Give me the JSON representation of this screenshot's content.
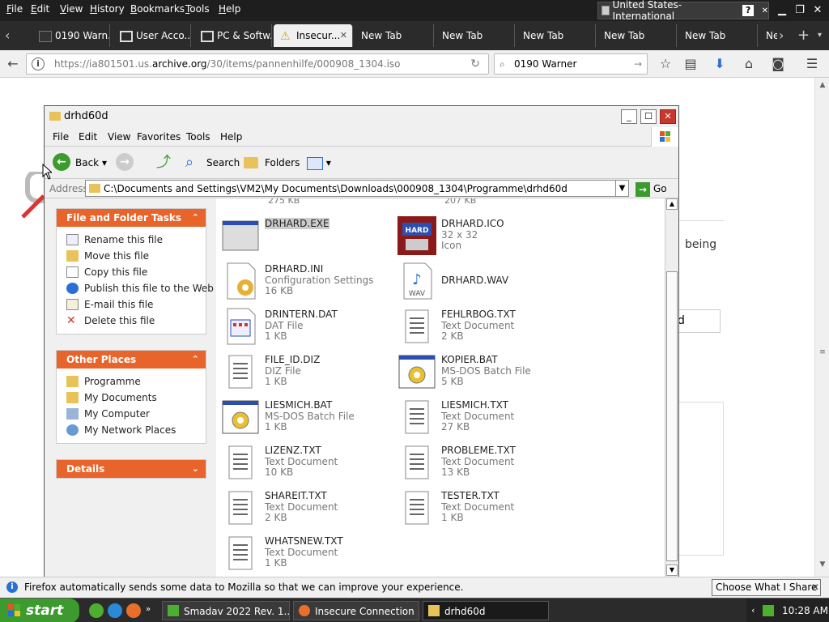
{
  "firefox": {
    "menu": [
      "File",
      "Edit",
      "View",
      "History",
      "Bookmarks",
      "Tools",
      "Help"
    ],
    "language": "United States-International",
    "tabs": [
      {
        "label": "0190 Warn...",
        "active": false
      },
      {
        "label": "User Acco...",
        "active": false
      },
      {
        "label": "PC & Softw...",
        "active": false
      },
      {
        "label": "Insecur...",
        "active": true
      },
      {
        "label": "New Tab",
        "active": false
      },
      {
        "label": "New Tab",
        "active": false
      },
      {
        "label": "New Tab",
        "active": false
      },
      {
        "label": "New Tab",
        "active": false
      },
      {
        "label": "New Tab",
        "active": false
      },
      {
        "label": "Ne",
        "active": false
      }
    ],
    "url_prefix": "https://ia801501.us.",
    "url_domain": "archive.org",
    "url_path": "/30/items/pannenhilfe/000908_1304.iso",
    "search_value": "0190 Warner",
    "notification": "Firefox automatically sends some data to Mozilla so that we can improve your experience.",
    "notification_button": "Choose What I Share"
  },
  "page": {
    "partial_text": "being",
    "partial_input": "d"
  },
  "explorer": {
    "title": "drhd60d",
    "menu": [
      "File",
      "Edit",
      "View",
      "Favorites",
      "Tools",
      "Help"
    ],
    "toolbar": {
      "back": "Back",
      "search": "Search",
      "folders": "Folders"
    },
    "address_label": "Address",
    "address": "C:\\Documents and Settings\\VM2\\My Documents\\Downloads\\000908_1304\\Programme\\drhd60d",
    "go": "Go",
    "file_tasks": {
      "title": "File and Folder Tasks",
      "items": [
        "Rename this file",
        "Move this file",
        "Copy this file",
        "Publish this file to the Web",
        "E-mail this file",
        "Delete this file"
      ]
    },
    "other_places": {
      "title": "Other Places",
      "items": [
        "Programme",
        "My Documents",
        "My Computer",
        "My Network Places"
      ]
    },
    "details": {
      "title": "Details"
    },
    "partial_sizes": [
      "275 KB",
      "207 KB"
    ],
    "files": [
      {
        "name": "DRHARD.EXE",
        "type": "",
        "size": "",
        "icon": "exe-icon",
        "selected": true
      },
      {
        "name": "DRHARD.ICO",
        "type": "32 x 32",
        "size": "Icon",
        "icon": "drhard-ico-icon",
        "selected": false
      },
      {
        "name": "DRHARD.INI",
        "type": "Configuration Settings",
        "size": "16 KB",
        "icon": "config-icon",
        "selected": false
      },
      {
        "name": "DRHARD.WAV",
        "type": "",
        "size": "",
        "icon": "wav-icon",
        "selected": false
      },
      {
        "name": "DRINTERN.DAT",
        "type": "DAT File",
        "size": "1 KB",
        "icon": "dat-icon",
        "selected": false
      },
      {
        "name": "FEHLRBOG.TXT",
        "type": "Text Document",
        "size": "2 KB",
        "icon": "text-icon",
        "selected": false
      },
      {
        "name": "FILE_ID.DIZ",
        "type": "DIZ File",
        "size": "1 KB",
        "icon": "text-icon",
        "selected": false
      },
      {
        "name": "KOPIER.BAT",
        "type": "MS-DOS Batch File",
        "size": "5 KB",
        "icon": "batch-icon",
        "selected": false
      },
      {
        "name": "LIESMICH.BAT",
        "type": "MS-DOS Batch File",
        "size": "1 KB",
        "icon": "batch-icon",
        "selected": false
      },
      {
        "name": "LIESMICH.TXT",
        "type": "Text Document",
        "size": "27 KB",
        "icon": "text-icon",
        "selected": false
      },
      {
        "name": "LIZENZ.TXT",
        "type": "Text Document",
        "size": "10 KB",
        "icon": "text-icon",
        "selected": false
      },
      {
        "name": "PROBLEME.TXT",
        "type": "Text Document",
        "size": "13 KB",
        "icon": "text-icon",
        "selected": false
      },
      {
        "name": "SHAREIT.TXT",
        "type": "Text Document",
        "size": "2 KB",
        "icon": "text-icon",
        "selected": false
      },
      {
        "name": "TESTER.TXT",
        "type": "Text Document",
        "size": "1 KB",
        "icon": "text-icon",
        "selected": false
      },
      {
        "name": "WHATSNEW.TXT",
        "type": "Text Document",
        "size": "1 KB",
        "icon": "text-icon",
        "selected": false
      }
    ]
  },
  "taskbar": {
    "start": "start",
    "items": [
      {
        "label": "Smadav 2022 Rev. 1...",
        "active": false
      },
      {
        "label": "Insecure Connection ...",
        "active": false
      },
      {
        "label": "drhd60d",
        "active": true
      }
    ],
    "clock": "10:28 AM"
  },
  "colors": {
    "xp_panel_header": "#e8642b",
    "start_green": "#3d9a2f",
    "selection": "#cccccc"
  }
}
